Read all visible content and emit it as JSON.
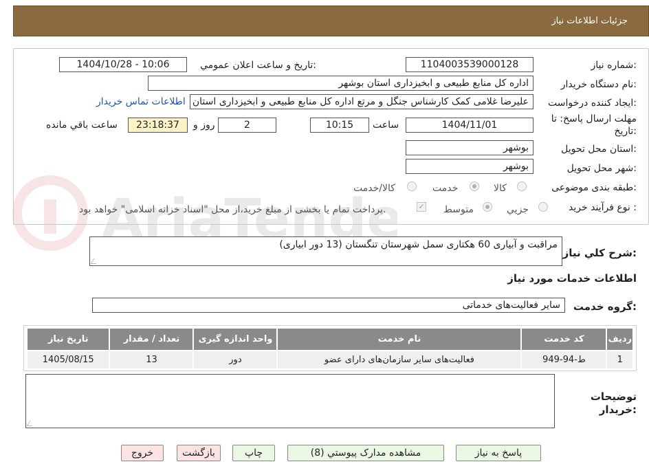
{
  "header": {
    "title": "جزئیات اطلاعات نیاز"
  },
  "form": {
    "need_number": {
      "label": "شماره نیاز:",
      "value": "1104003539000128"
    },
    "announce": {
      "label": "تاریخ و ساعت اعلان عمومي:",
      "value": "1404/10/28 - 10:06"
    },
    "buyer_org": {
      "label": "نام دستگاه خریدار:",
      "value": "اداره کل منابع طبیعی و ابخیزداری استان بوشهر"
    },
    "requester": {
      "label": "ایجاد کننده درخواست:",
      "value": "علیرضا غلامی کمک کارشناس جنگل و مرتع اداره کل منابع طبیعی و ابخیزداری استان بوشهر"
    },
    "contact_link": "اطلاعات تماس خریدار",
    "deadline": {
      "label_line1": "مهلت ارسال پاسخ: تا",
      "label_line2": "تاریخ:",
      "date": "1404/11/01",
      "time_label": "ساعت",
      "time": "10:15",
      "days": "2",
      "days_label": "روز و",
      "remaining": "23:18:37",
      "remaining_label": "ساعت باقي مانده"
    },
    "province": {
      "label": "استان محل تحویل:",
      "value": "بوشهر"
    },
    "city": {
      "label": "شهر محل تحویل:",
      "value": "بوشهر"
    },
    "category": {
      "label": "طبقه بندی موضوعی:",
      "options": [
        "کالا",
        "خدمت",
        "کالا/خدمت"
      ],
      "selected": "خدمت"
    },
    "process": {
      "label": "نوع فرآیند خرید :",
      "options": [
        "جزیي",
        "متوسط"
      ],
      "selected": "متوسط",
      "payment_note": "پرداخت تمام یا بخشی از مبلغ خرید،از محل \"اسناد خزانه اسلامی\" خواهد بود."
    }
  },
  "description": {
    "label": "شرح کلي نیاز:",
    "value": "مراقبت و آبیاری 60 هکتاری سمل شهرستان تنگستان (13 دور ابیاری)"
  },
  "services": {
    "section_title": "اطلاعات خدمات مورد نیاز",
    "group_label": "گروه خدمت:",
    "group_value": "سایر فعالیت‌های خدماتی",
    "table": {
      "headers": [
        "ردیف",
        "کد خدمت",
        "نام خدمت",
        "واحد اندازه گیری",
        "تعداد / مقدار",
        "تاریخ نیاز"
      ],
      "rows": [
        [
          "1",
          "ط-94-949",
          "فعالیت‌های سایر سازمان‌های دارای عضو",
          "دور",
          "13",
          "1405/08/15"
        ]
      ]
    }
  },
  "buyer_notes": {
    "label_line1": "توضیحات",
    "label_line2": "خریدار:"
  },
  "buttons": {
    "reply": "پاسخ به نیاز",
    "attachments": "مشاهده مدارک پیوستي (8)",
    "print": "چاپ",
    "back": "بازگشت",
    "exit": "خروج"
  },
  "colors": {
    "header_bg": "#8b6a40",
    "table_header_bg": "#8a8a8a",
    "link": "#1a55b8"
  }
}
